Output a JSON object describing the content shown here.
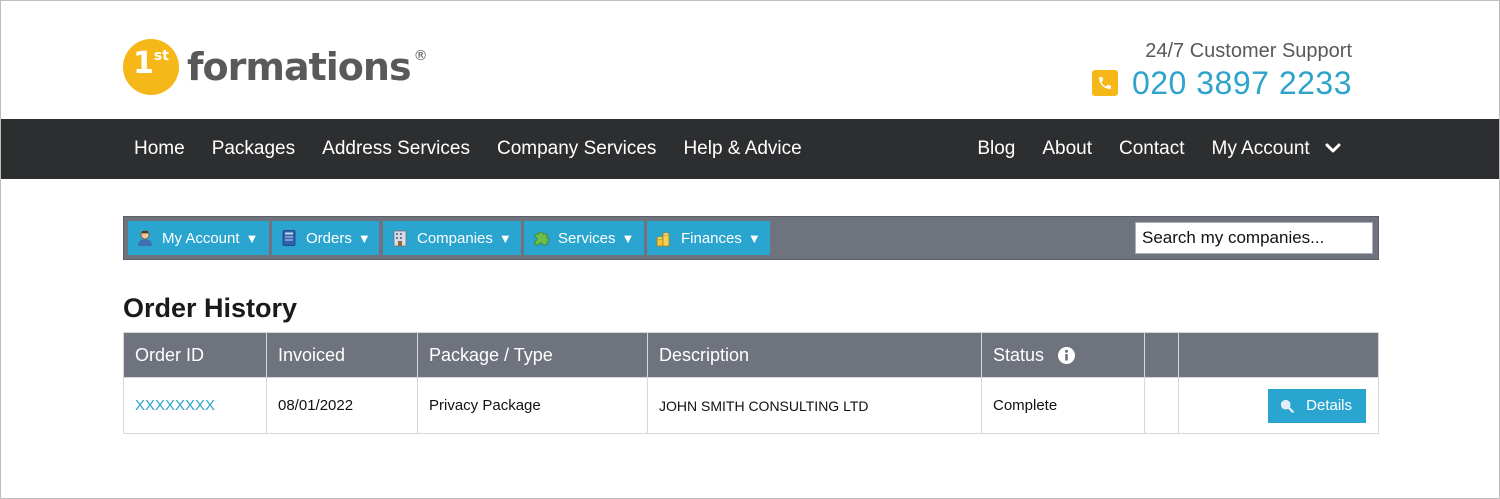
{
  "brand": {
    "logo_number": "1",
    "logo_superscript": "st",
    "logo_word": "formations",
    "logo_registered": "®",
    "accent_color": "#f6b719",
    "link_color": "#2ea3cc"
  },
  "support": {
    "label": "24/7 Customer Support",
    "phone": "020 3897 2233",
    "icon": "phone-icon"
  },
  "mainnav": {
    "left": [
      "Home",
      "Packages",
      "Address Services",
      "Company Services",
      "Help & Advice"
    ],
    "right": [
      "Blog",
      "About",
      "Contact",
      "My Account"
    ],
    "account_icon": "chevron-down-icon"
  },
  "toolbar": {
    "buttons": [
      {
        "label": "My Account",
        "icon": "user-icon"
      },
      {
        "label": "Orders",
        "icon": "book-icon"
      },
      {
        "label": "Companies",
        "icon": "building-icon"
      },
      {
        "label": "Services",
        "icon": "puzzle-icon"
      },
      {
        "label": "Finances",
        "icon": "coins-icon"
      }
    ],
    "arrow": "▼",
    "search_placeholder": "Search my companies..."
  },
  "page": {
    "title": "Order History"
  },
  "table": {
    "columns": [
      "Order ID",
      "Invoiced",
      "Package / Type",
      "Description",
      "Status",
      "",
      ""
    ],
    "status_info_icon": "info-icon",
    "rows": [
      {
        "order_id": "XXXXXXXX",
        "invoiced": "08/01/2022",
        "package": "Privacy Package",
        "description": "JOHN SMITH CONSULTING LTD",
        "status": "Complete",
        "action_label": "Details",
        "action_icon": "magnifier-icon"
      }
    ]
  }
}
